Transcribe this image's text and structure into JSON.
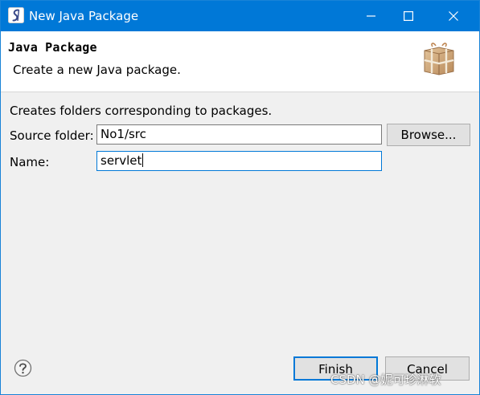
{
  "window": {
    "title": "New Java Package",
    "icons": {
      "app": "eclipse-icon",
      "minimize": "minimize-icon",
      "maximize": "maximize-icon",
      "close": "close-icon"
    },
    "colors": {
      "titlebar": "#0078d7",
      "accent": "#0078d7",
      "background": "#f0f0f0"
    }
  },
  "banner": {
    "title": "Java Package",
    "description": "Create a new Java package.",
    "icon": "package-icon"
  },
  "form": {
    "description": "Creates folders corresponding to packages.",
    "source_folder": {
      "label": "Source folder:",
      "value": "No1/src"
    },
    "name": {
      "label": "Name:",
      "value": "servlet"
    },
    "browse_label": "Browse..."
  },
  "footer": {
    "help_icon": "help-icon",
    "finish_label": "Finish",
    "cancel_label": "Cancel"
  },
  "watermark": "CSDN @妮可珍淋软"
}
